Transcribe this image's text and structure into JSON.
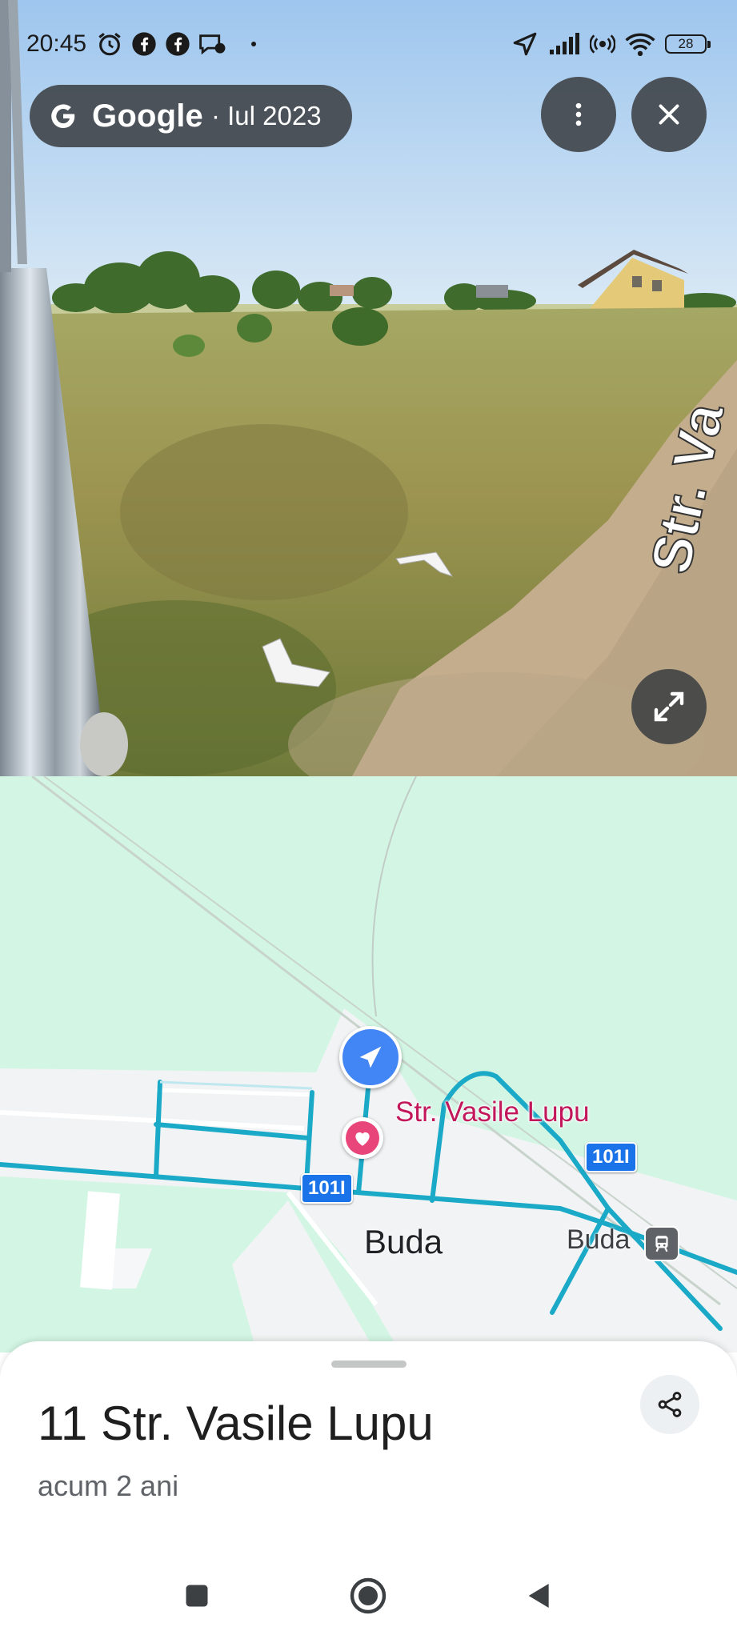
{
  "status_bar": {
    "time": "20:45",
    "battery": "28",
    "left_icons": [
      "alarm-icon",
      "facebook-icon",
      "facebook-icon",
      "messenger-icon"
    ],
    "right_icons": [
      "location-arrow-icon",
      "signal-icon",
      "hotspot-icon",
      "wifi-icon",
      "battery-icon"
    ]
  },
  "streetview": {
    "brand": "Google",
    "date": "· Iul 2023",
    "road_text": "Str. Va"
  },
  "map": {
    "street_label": "Str. Vasile Lupu",
    "town_label": "Buda",
    "station_label": "Buda",
    "route_shield_1": "101I",
    "route_shield_2": "101I"
  },
  "place": {
    "title": "11 Str. Vasile Lupu",
    "subtitle": "acum 2 ani"
  },
  "colors": {
    "map_land": "#d3f6e4",
    "road_blue": "#1aa9c6",
    "pin_red": "#e8457a",
    "pegman_blue": "#4285f4",
    "street_label": "#c2185b"
  }
}
